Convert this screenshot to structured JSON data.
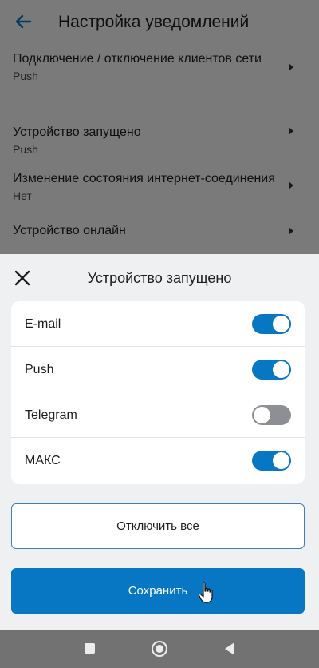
{
  "page": {
    "title": "Настройка уведомлений",
    "settings": [
      {
        "label": "Подключение / отключение клиентов сети",
        "value": "Push"
      },
      {
        "label": "Устройство запущено",
        "value": "Push"
      },
      {
        "label": "Изменение состояния интернет-соединения",
        "value": "Нет"
      },
      {
        "label": "Устройство онлайн",
        "value": ""
      }
    ]
  },
  "sheet": {
    "title": "Устройство запущено",
    "channels": [
      {
        "label": "E-mail",
        "enabled": true
      },
      {
        "label": "Push",
        "enabled": true
      },
      {
        "label": "Telegram",
        "enabled": false
      },
      {
        "label": "МАКС",
        "enabled": true
      }
    ],
    "disable_all_label": "Отключить все",
    "save_label": "Сохранить"
  },
  "colors": {
    "accent": "#0777c4",
    "toggle_off": "#8e8f95",
    "sheet_bg": "#eff0f2"
  },
  "icons": {
    "back": "arrow-left-icon",
    "close": "close-icon",
    "row_arrow": "chevron-right-icon",
    "cursor": "hand-pointer-icon"
  }
}
